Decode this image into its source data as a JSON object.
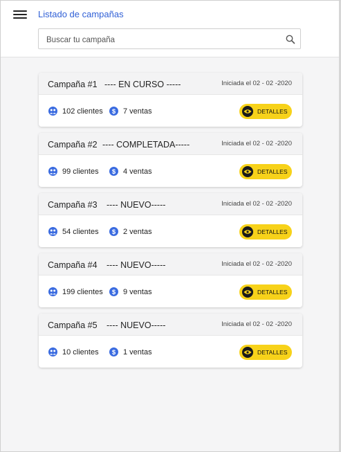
{
  "header": {
    "menu_icon": "hamburger-menu-icon",
    "title": "Listado de campañas",
    "search": {
      "placeholder": "Buscar tu campaña",
      "value": "",
      "icon": "search-icon"
    }
  },
  "colors": {
    "accent": "#f7d21a",
    "link": "#2f5fd6",
    "icon_blue": "#3a6be0"
  },
  "campaigns": [
    {
      "name": "Campaña #1",
      "status": "---- EN CURSO -----",
      "date": "Iniciada el 02 - 02 -2020",
      "clients": "102 clientes",
      "sales": "7 ventas",
      "button": "DETALLES"
    },
    {
      "name": "Campaña #2",
      "status": "---- COMPLETADA-----",
      "date": "Iniciada el 02 - 02 -2020",
      "clients": "99 clientes",
      "sales": "4 ventas",
      "button": "DETALLES"
    },
    {
      "name": "Campaña #3",
      "status": "---- NUEVO-----",
      "date": "Iniciada el 02 - 02 -2020",
      "clients": "54 clientes",
      "sales": "2 ventas",
      "button": "DETALLES"
    },
    {
      "name": "Campaña #4",
      "status": "---- NUEVO-----",
      "date": "Iniciada el 02 - 02 -2020",
      "clients": "199 clientes",
      "sales": "9 ventas",
      "button": "DETALLES"
    },
    {
      "name": "Campaña #5",
      "status": "---- NUEVO-----",
      "date": "Iniciada el 02 - 02 -2020",
      "clients": "10 clientes",
      "sales": "1 ventas",
      "button": "DETALLES"
    }
  ]
}
